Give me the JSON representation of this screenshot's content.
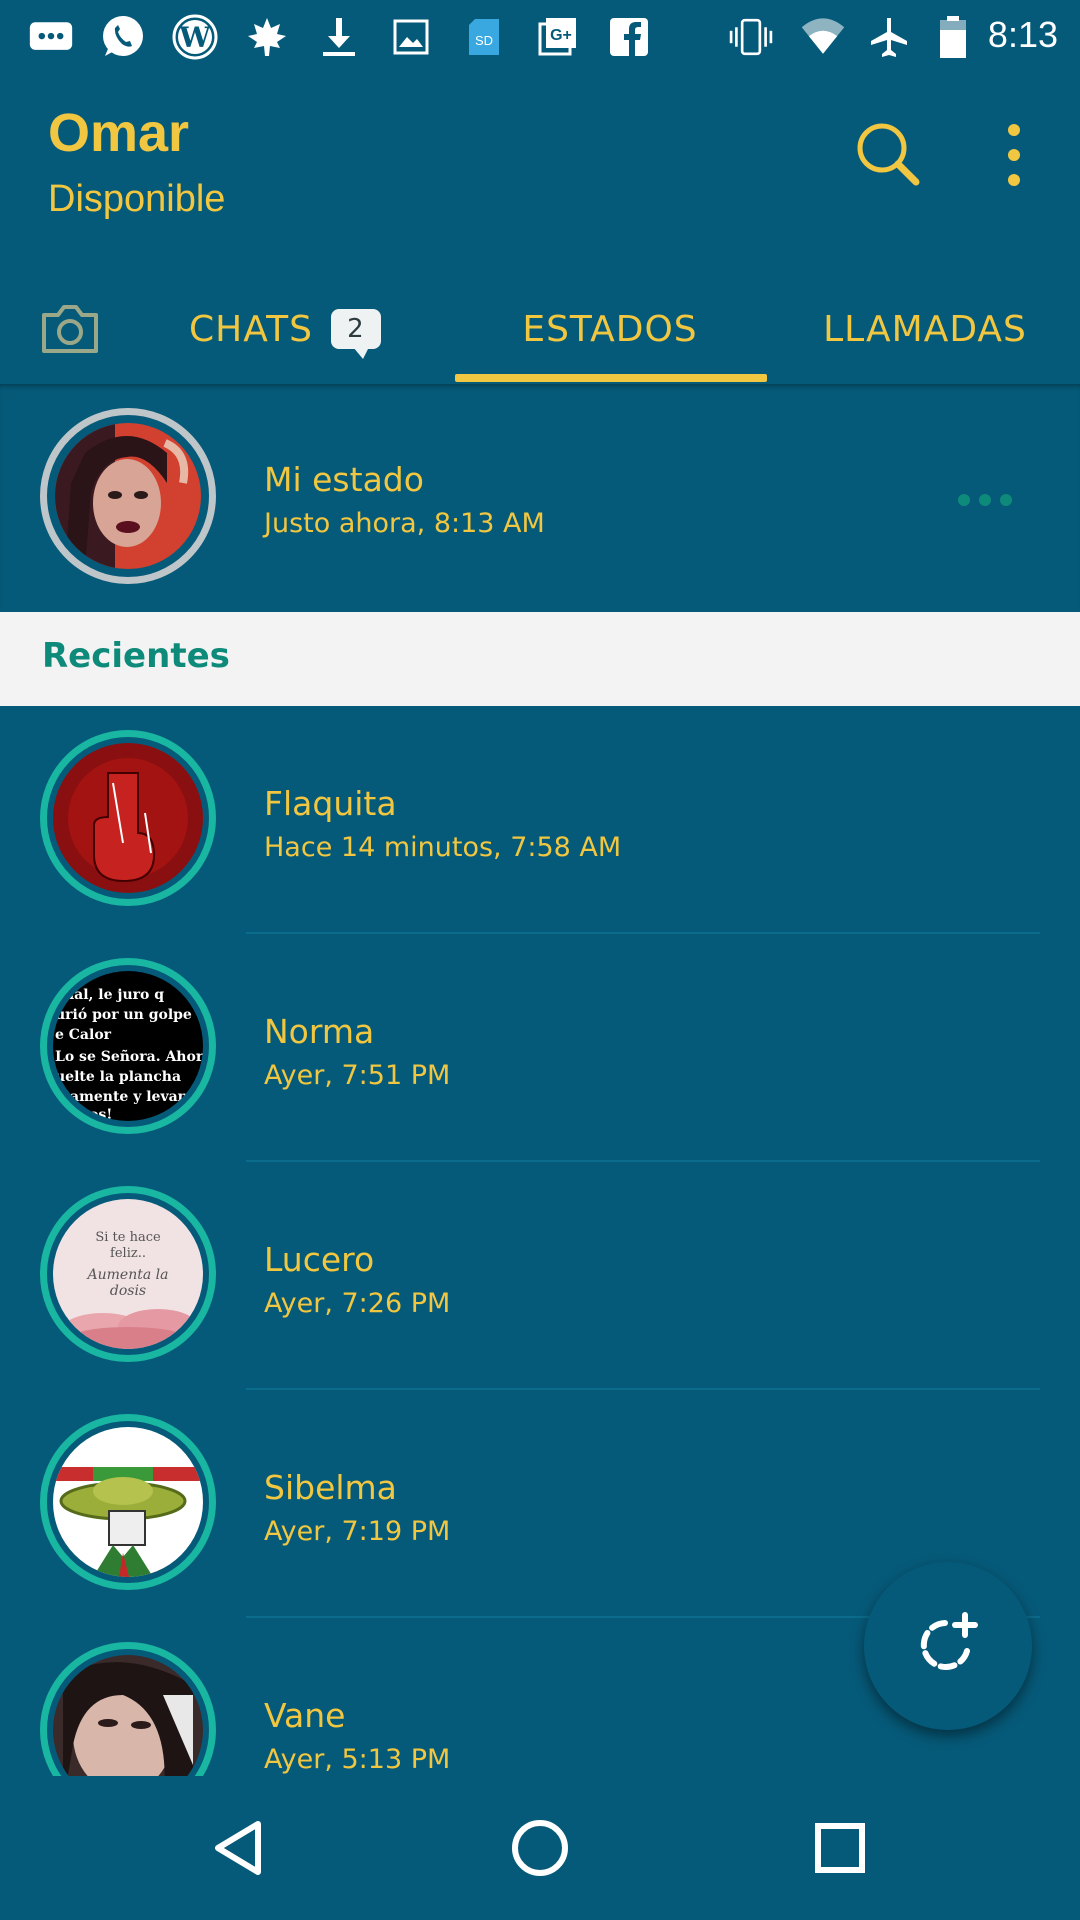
{
  "statusbar": {
    "time": "8:13",
    "icons": [
      "message-icon",
      "whatsapp-icon",
      "wordpress-icon",
      "leaf-icon",
      "download-icon",
      "image-icon",
      "sd-card-icon",
      "google-plus-icon",
      "facebook-icon",
      "vibrate-icon",
      "wifi-icon",
      "airplane-icon",
      "battery-icon"
    ]
  },
  "header": {
    "title": "Omar",
    "subtitle": "Disponible"
  },
  "tabs": {
    "chats": "CHATS",
    "chats_badge": "2",
    "estados": "ESTADOS",
    "llamadas": "LLAMADAS",
    "selected": "ESTADOS"
  },
  "my_status": {
    "name": "Mi estado",
    "time": "Justo ahora, 8:13 AM"
  },
  "recent_header": "Recientes",
  "statuses": [
    {
      "name": "Flaquita",
      "time": "Hace 14 minutos, 7:58 AM"
    },
    {
      "name": "Norma",
      "time": "Ayer, 7:51 PM"
    },
    {
      "name": "Lucero",
      "time": "Ayer, 7:26 PM"
    },
    {
      "name": "Sibelma",
      "time": "Ayer, 7:19 PM"
    },
    {
      "name": "Vane",
      "time": "Ayer, 5:13 PM"
    }
  ],
  "thumb_texts": {
    "norma": [
      "icial, le juro q",
      "urió por un golpe",
      "e Calor",
      " Lo se Señora. Ahor",
      "uelte la plancha",
      "ctamente y levant",
      "manos!"
    ],
    "lucero": [
      "Si te hace",
      "feliz..",
      "Aumenta la",
      "dosis"
    ]
  },
  "colors": {
    "background": "#065a79",
    "accent": "#f1c640",
    "teal": "#19b7a1",
    "section_bg": "#f3f3f3"
  }
}
